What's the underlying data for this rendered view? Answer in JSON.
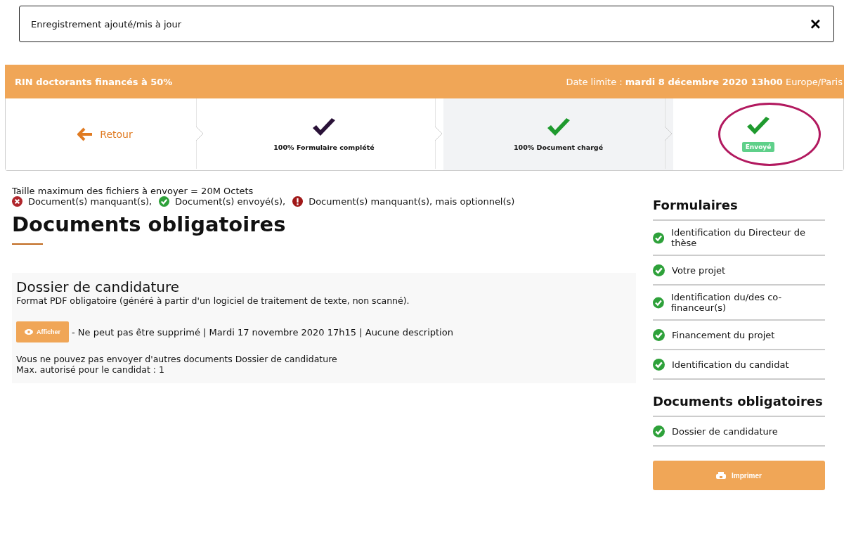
{
  "notification": {
    "message": "Enregistrement ajouté/mis à jour",
    "close": "×"
  },
  "header": {
    "title": "RIN doctorants financés à 50%",
    "deadline_label": "Date limite :",
    "deadline": "mardi 8 décembre 2020 13h00",
    "timezone": "Europe/Paris"
  },
  "steps": [
    {
      "kind": "back",
      "label": "Retour",
      "selected": false
    },
    {
      "kind": "step",
      "label": "100% Formulaire complété",
      "color": "#2a1238",
      "selected": false
    },
    {
      "kind": "step",
      "label": "100% Document chargé",
      "color": "#1f9a2e",
      "selected": true
    },
    {
      "kind": "badge",
      "label": "Envoyé",
      "color": "#1f9a2e",
      "selected": false,
      "circled": true
    }
  ],
  "info": "Taille maximum des fichiers à envoyer = 20M Octets",
  "legend": [
    {
      "kind": "missing",
      "label": "Document(s) manquant(s),"
    },
    {
      "kind": "sent",
      "label": "Document(s) envoyé(s),"
    },
    {
      "kind": "optional",
      "label": "Document(s) manquant(s), mais optionnel(s)"
    }
  ],
  "section_title": "Documents obligatoires",
  "document": {
    "title": "Dossier de candidature",
    "format": "Format PDF obligatoire (généré à partir d'un logiciel de traitement de texte, non scanné).",
    "button": "Afficher",
    "details": "- Ne peut pas être supprimé | Mardi 17 novembre 2020 17h15 | Aucune description",
    "notes": [
      "Vous ne pouvez pas envoyer d'autres documents Dossier de candidature",
      "Max. autorisé pour le candidat : 1"
    ]
  },
  "sidebar": [
    {
      "title": "Formulaires",
      "items": [
        {
          "label": "Identification du Directeur de thèse",
          "done": true
        },
        {
          "label": "Votre projet",
          "done": true
        },
        {
          "label": "Identification du/des co-financeur(s)",
          "done": true
        },
        {
          "label": "Financement du projet",
          "done": true
        },
        {
          "label": "Identification du candidat",
          "done": true
        }
      ]
    },
    {
      "title": "Documents obligatoires",
      "items": [
        {
          "label": "Dossier de candidature",
          "done": true
        }
      ]
    }
  ],
  "print_button": "Imprimer"
}
